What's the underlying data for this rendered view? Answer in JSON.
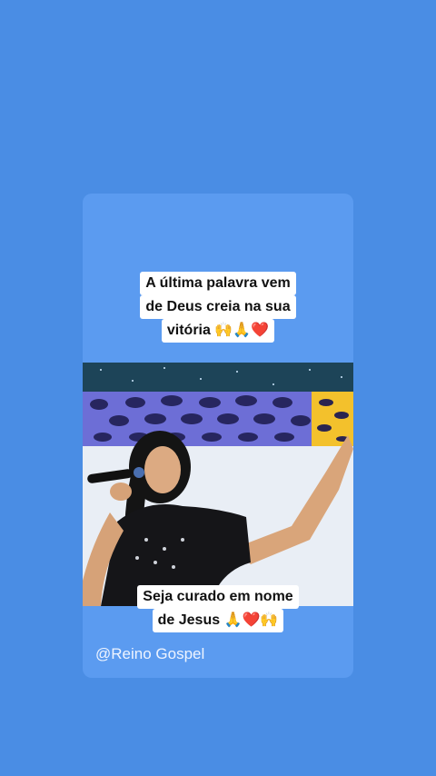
{
  "story": {
    "caption_top": [
      "A última palavra vem",
      "de Deus creia na sua",
      "vitória 🙌🙏❤️"
    ],
    "caption_bottom": [
      "Seja curado em nome",
      "de Jesus 🙏❤️🙌"
    ],
    "watermark": "@Reino Gospel"
  },
  "colors": {
    "background": "#4a8de4",
    "card": "#5b9bf0"
  }
}
